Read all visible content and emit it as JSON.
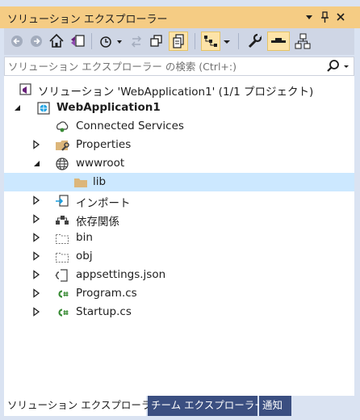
{
  "window": {
    "title": "ソリューション エクスプローラー",
    "dropdown_icon": "dropdown-arrow-icon",
    "pin_icon": "pin-icon",
    "close_icon": "close-icon",
    "accent": "#f5cc84"
  },
  "toolbar": {
    "buttons": [
      "back-icon",
      "forward-icon",
      "home-icon",
      "switch-views-icon",
      "history-icon",
      "sync-icon",
      "collapse-all-icon",
      "show-all-files-icon",
      "preview-icon",
      "properties-icon",
      "pending-changes-filter-icon",
      "view-class-diagram-icon"
    ]
  },
  "search": {
    "placeholder": "ソリューション エクスプローラー の検索 (Ctrl+:)"
  },
  "tree": {
    "solution": "ソリューション 'WebApplication1' (1/1 プロジェクト)",
    "project": "WebApplication1",
    "items": [
      {
        "label": "Connected Services"
      },
      {
        "label": "Properties"
      },
      {
        "label": "wwwroot"
      },
      {
        "label": "lib"
      },
      {
        "label": "インポート"
      },
      {
        "label": "依存関係"
      },
      {
        "label": "bin"
      },
      {
        "label": "obj"
      },
      {
        "label": "appsettings.json"
      },
      {
        "label": "Program.cs"
      },
      {
        "label": "Startup.cs"
      }
    ]
  },
  "tabs": [
    {
      "label": "ソリューション エクスプローラー",
      "active": true
    },
    {
      "label": "チーム エクスプローラー",
      "active": false
    },
    {
      "label": "通知",
      "active": false
    }
  ]
}
